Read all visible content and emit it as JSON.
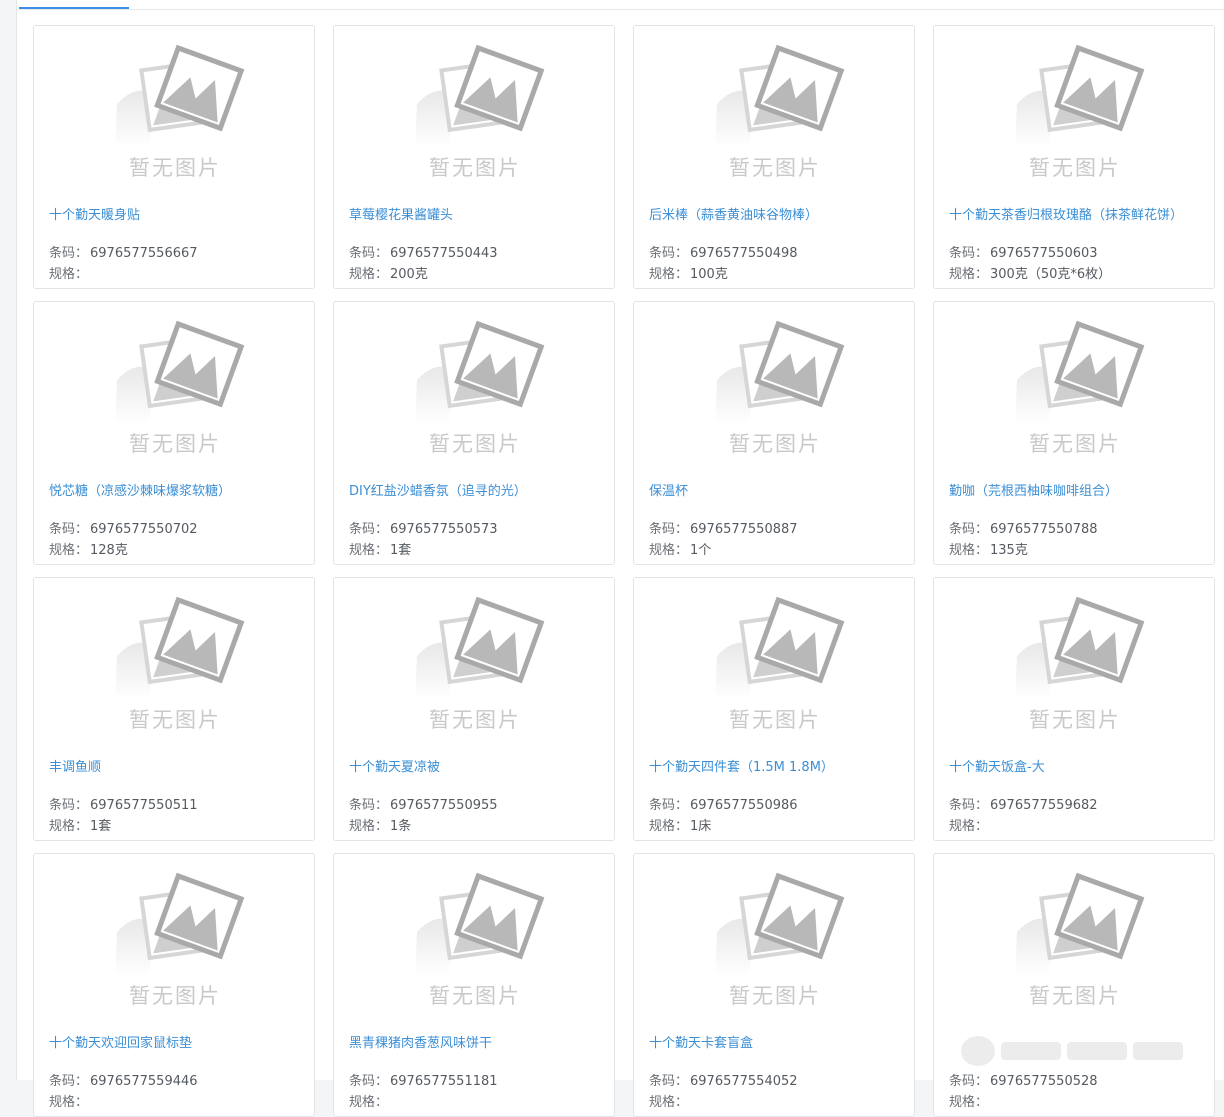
{
  "no_image_text": "暂无图片",
  "labels": {
    "barcode": "条码：",
    "spec": "规格："
  },
  "products": [
    {
      "name": "十个勤天暖身贴",
      "barcode": "6976577556667",
      "spec": ""
    },
    {
      "name": "草莓樱花果酱罐头",
      "barcode": "6976577550443",
      "spec": "200克"
    },
    {
      "name": "后米棒（蒜香黄油味谷物棒）",
      "barcode": "6976577550498",
      "spec": "100克"
    },
    {
      "name": "十个勤天茶香归根玫瑰酪（抹茶鲜花饼）",
      "barcode": "6976577550603",
      "spec": "300克（50克*6枚）"
    },
    {
      "name": "悦芯糖（凉感沙棘味爆浆软糖）",
      "barcode": "6976577550702",
      "spec": "128克"
    },
    {
      "name": "DIY红盐沙蜡香氛（追寻的光）",
      "barcode": "6976577550573",
      "spec": "1套"
    },
    {
      "name": "保温杯",
      "barcode": "6976577550887",
      "spec": "1个"
    },
    {
      "name": "勤咖（芫根西柚味咖啡组合）",
      "barcode": "6976577550788",
      "spec": "135克"
    },
    {
      "name": "丰调鱼顺",
      "barcode": "6976577550511",
      "spec": "1套"
    },
    {
      "name": "十个勤天夏凉被",
      "barcode": "6976577550955",
      "spec": "1条"
    },
    {
      "name": "十个勤天四件套（1.5M 1.8M）",
      "barcode": "6976577550986",
      "spec": "1床"
    },
    {
      "name": "十个勤天饭盒-大",
      "barcode": "6976577559682",
      "spec": ""
    },
    {
      "name": "十个勤天欢迎回家鼠标垫",
      "barcode": "6976577559446",
      "spec": ""
    },
    {
      "name": "黑青稞猪肉香葱风味饼干",
      "barcode": "6976577551181",
      "spec": ""
    },
    {
      "name": "十个勤天卡套盲盒",
      "barcode": "6976577554052",
      "spec": ""
    },
    {
      "name": "",
      "barcode": "6976577550528",
      "spec": ""
    }
  ]
}
